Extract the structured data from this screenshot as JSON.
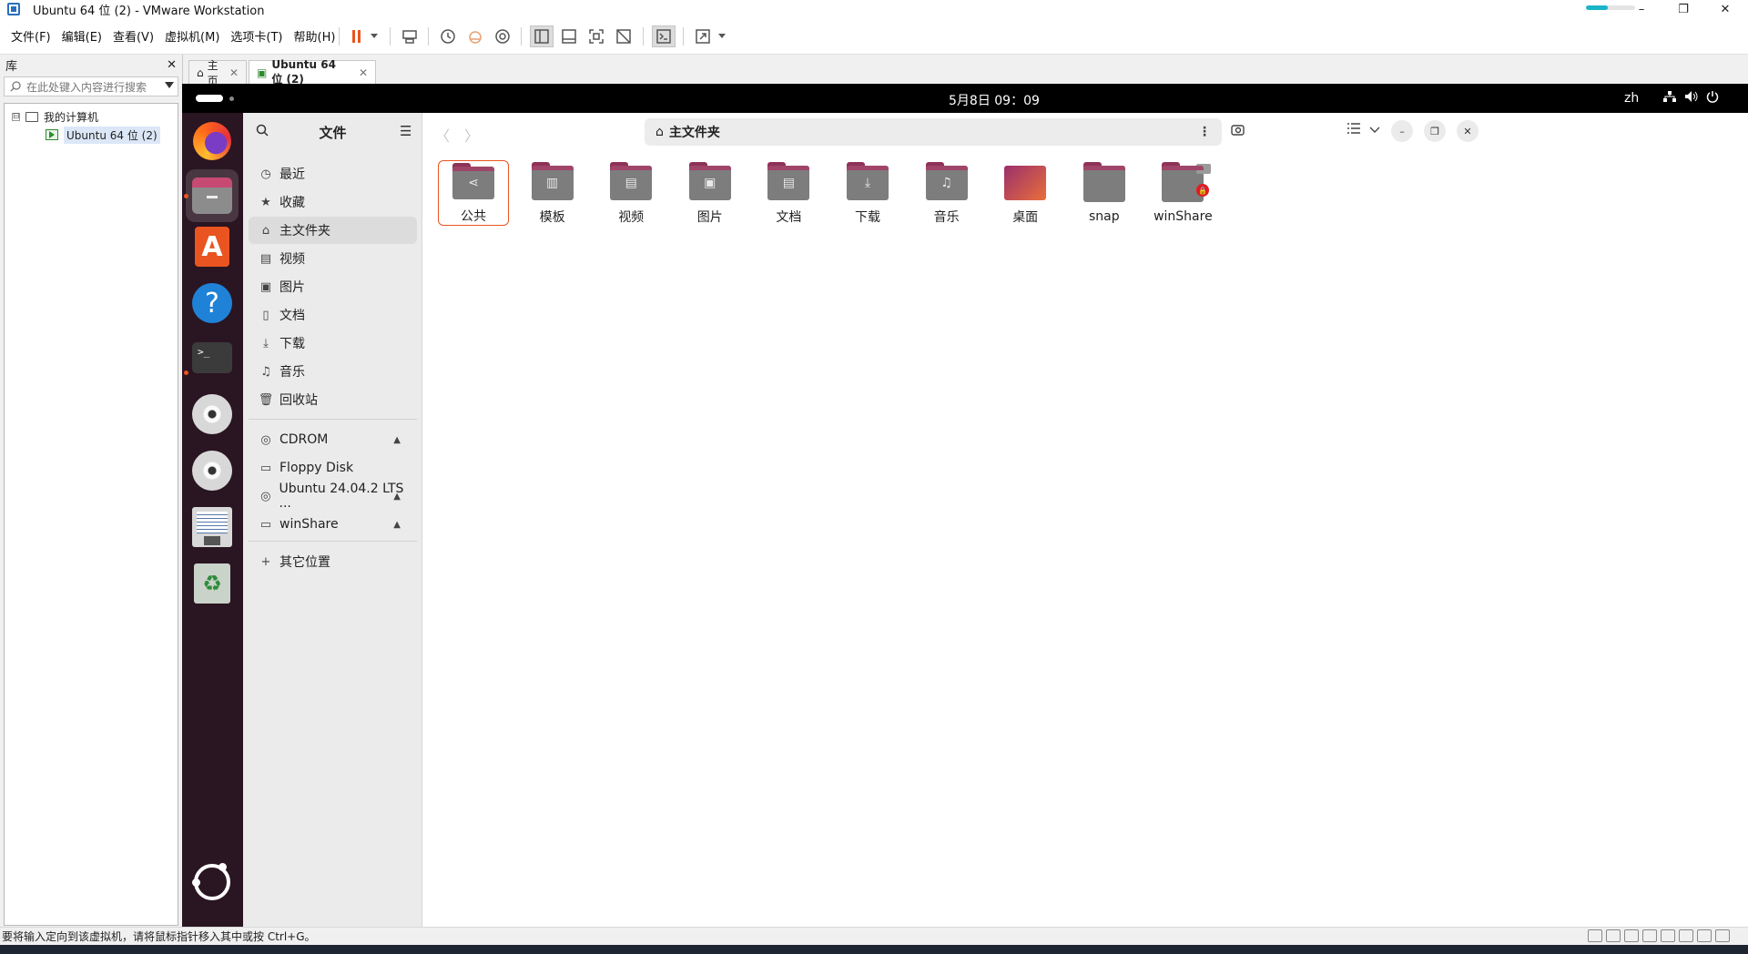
{
  "window": {
    "title": "Ubuntu 64 位 (2) - VMware Workstation",
    "controls": {
      "minimize": "–",
      "maximize": "❐",
      "close": "✕"
    },
    "progress_fraction": 0.45,
    "accent_color": "#18b4c8"
  },
  "menubar": {
    "items": [
      "文件(F)",
      "编辑(E)",
      "查看(V)",
      "虚拟机(M)",
      "选项卡(T)",
      "帮助(H)"
    ]
  },
  "toolbar": {
    "icons": [
      "pause-icon",
      "dropdown-icon",
      "send-keys-icon",
      "snapshot-icon",
      "revert-snapshot-icon",
      "snapshot-manager-icon",
      "library-view-icon",
      "thumbnail-bar-icon",
      "fullscreen-icon",
      "unity-icon",
      "console-icon",
      "stretch-icon",
      "dropdown-icon"
    ],
    "pause_color": "#e95420"
  },
  "library": {
    "title": "库",
    "close": "✕",
    "search_placeholder": "在此处键入内容进行搜索",
    "tree": {
      "root": "我的计算机",
      "expander": "⊟",
      "child": "Ubuntu 64 位 (2)"
    }
  },
  "tabs": [
    {
      "label": "主页",
      "close": "✕"
    },
    {
      "label": "Ubuntu 64 位 (2)",
      "close": "✕"
    }
  ],
  "ubuntu": {
    "topbar": {
      "clock": "5月8日  09：09",
      "lang": "zh",
      "icons": [
        "network-icon",
        "volume-icon",
        "power-icon"
      ]
    },
    "dock": {
      "apps": [
        "firefox-icon",
        "files-icon",
        "app-center-icon",
        "help-icon",
        "terminal-icon",
        "cdrom-icon",
        "cdrom-icon",
        "floppy-icon",
        "trash-icon",
        "show-apps-icon"
      ],
      "running_color": "#e95420"
    },
    "files": {
      "sidebar_title": "文件",
      "places": [
        {
          "label": "最近",
          "icon": "clock-icon",
          "glyph": "◷"
        },
        {
          "label": "收藏",
          "icon": "star-icon",
          "glyph": "★"
        },
        {
          "label": "主文件夹",
          "icon": "home-icon",
          "glyph": "⌂"
        },
        {
          "label": "视频",
          "icon": "video-icon",
          "glyph": "▤"
        },
        {
          "label": "图片",
          "icon": "image-icon",
          "glyph": "▣"
        },
        {
          "label": "文档",
          "icon": "document-icon",
          "glyph": "▯"
        },
        {
          "label": "下载",
          "icon": "download-icon",
          "glyph": "⤓"
        },
        {
          "label": "音乐",
          "icon": "music-icon",
          "glyph": "♫"
        },
        {
          "label": "回收站",
          "icon": "trash-icon",
          "glyph": "🗑"
        }
      ],
      "devices": [
        {
          "label": "CDROM",
          "icon": "disc-icon",
          "glyph": "◎",
          "eject": "▲"
        },
        {
          "label": "Floppy Disk",
          "icon": "floppy-icon",
          "glyph": "▭",
          "eject": ""
        },
        {
          "label": "Ubuntu 24.04.2 LTS ...",
          "icon": "disc-icon",
          "glyph": "◎",
          "eject": "▲"
        },
        {
          "label": "winShare",
          "icon": "drive-icon",
          "glyph": "▭",
          "eject": "▲"
        }
      ],
      "other_locations": {
        "label": "其它位置",
        "glyph": "+"
      },
      "path": "主文件夹",
      "nav": {
        "back": "〈",
        "forward": "〉"
      },
      "folders": [
        {
          "label": "公共",
          "glyph": "⋖",
          "icon": "share-icon"
        },
        {
          "label": "模板",
          "glyph": "▥",
          "icon": "template-icon"
        },
        {
          "label": "视频",
          "glyph": "▤",
          "icon": "video-icon"
        },
        {
          "label": "图片",
          "glyph": "▣",
          "icon": "image-icon"
        },
        {
          "label": "文档",
          "glyph": "▤",
          "icon": "document-icon"
        },
        {
          "label": "下载",
          "glyph": "⤓",
          "icon": "download-icon"
        },
        {
          "label": "音乐",
          "glyph": "♫",
          "icon": "music-icon"
        },
        {
          "label": "桌面",
          "glyph": "",
          "icon": "desktop-icon"
        },
        {
          "label": "snap",
          "glyph": "",
          "icon": "folder-icon"
        },
        {
          "label": "winShare",
          "glyph": "",
          "icon": "folder-icon"
        }
      ],
      "accent_color": "#e95420"
    }
  },
  "statusbar": {
    "message": "要将输入定向到该虚拟机，请将鼠标指针移入其中或按 Ctrl+G。"
  }
}
